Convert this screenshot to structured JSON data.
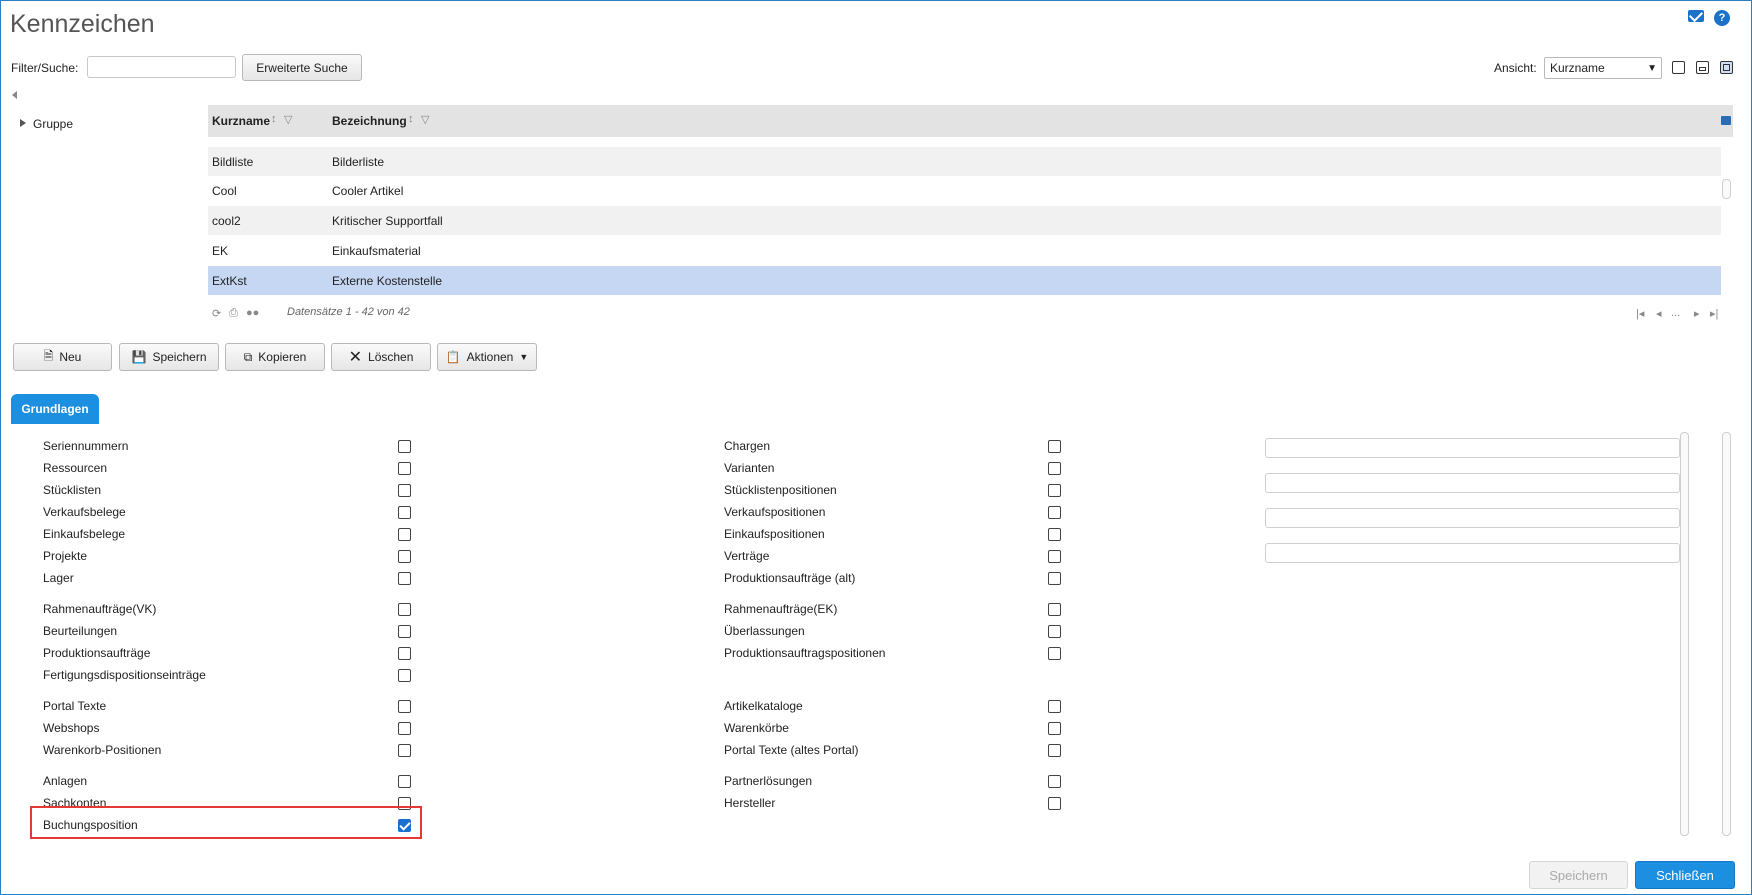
{
  "header": {
    "title": "Kennzeichen"
  },
  "filter": {
    "label": "Filter/Suche:",
    "value": "",
    "advanced_search": "Erweiterte Suche"
  },
  "view": {
    "label": "Ansicht:",
    "selected": "Kurzname"
  },
  "tree": {
    "group_label": "Gruppe"
  },
  "grid": {
    "columns": [
      "Kurzname",
      "Bezeichnung"
    ],
    "rows": [
      {
        "short": "Bildliste",
        "name": "Bilderliste"
      },
      {
        "short": "Cool",
        "name": "Cooler Artikel"
      },
      {
        "short": "cool2",
        "name": "Kritischer Supportfall"
      },
      {
        "short": "EK",
        "name": "Einkaufsmaterial"
      },
      {
        "short": "ExtKst",
        "name": "Externe Kostenstelle"
      }
    ],
    "selected_row": 4,
    "records": "Datensätze 1 - 42 von 42",
    "pager_ellipsis": "..."
  },
  "toolbar": {
    "new": "Neu",
    "save": "Speichern",
    "copy": "Kopieren",
    "delete": "Löschen",
    "actions": "Aktionen"
  },
  "tab": {
    "label": "Grundlagen"
  },
  "left_column": [
    {
      "label": "Seriennummern",
      "checked": false
    },
    {
      "label": "Ressourcen",
      "checked": false
    },
    {
      "label": "Stücklisten",
      "checked": false
    },
    {
      "label": "Verkaufsbelege",
      "checked": false
    },
    {
      "label": "Einkaufsbelege",
      "checked": false
    },
    {
      "label": "Projekte",
      "checked": false
    },
    {
      "label": "Lager",
      "checked": false
    },
    {
      "label": "Rahmenaufträge(VK)",
      "checked": false
    },
    {
      "label": "Beurteilungen",
      "checked": false
    },
    {
      "label": "Produktionsaufträge",
      "checked": false
    },
    {
      "label": "Fertigungsdispositionseinträge",
      "checked": false
    },
    {
      "label": "Portal Texte",
      "checked": false
    },
    {
      "label": "Webshops",
      "checked": false
    },
    {
      "label": "Warenkorb-Positionen",
      "checked": false
    },
    {
      "label": "Anlagen",
      "checked": false
    },
    {
      "label": "Sachkonten",
      "checked": false
    },
    {
      "label": "Buchungsposition",
      "checked": true
    }
  ],
  "right_column": [
    {
      "label": "Chargen",
      "checked": false
    },
    {
      "label": "Varianten",
      "checked": false
    },
    {
      "label": "Stücklistenpositionen",
      "checked": false
    },
    {
      "label": "Verkaufspositionen",
      "checked": false
    },
    {
      "label": "Einkaufspositionen",
      "checked": false
    },
    {
      "label": "Verträge",
      "checked": false
    },
    {
      "label": "Produktionsaufträge (alt)",
      "checked": false
    },
    {
      "label": "Rahmenaufträge(EK)",
      "checked": false
    },
    {
      "label": "Überlassungen",
      "checked": false
    },
    {
      "label": "Produktionsauftragspositionen",
      "checked": false
    },
    {
      "label": "Artikelkataloge",
      "checked": false
    },
    {
      "label": "Warenkörbe",
      "checked": false
    },
    {
      "label": "Portal Texte (altes Portal)",
      "checked": false
    },
    {
      "label": "Partnerlösungen",
      "checked": false
    },
    {
      "label": "Hersteller",
      "checked": false
    }
  ],
  "footer": {
    "save": "Speichern",
    "close": "Schließen"
  },
  "colors": {
    "accent": "#1d8fe0",
    "selected_row": "#c5d7f2",
    "highlight": "#e53935"
  }
}
